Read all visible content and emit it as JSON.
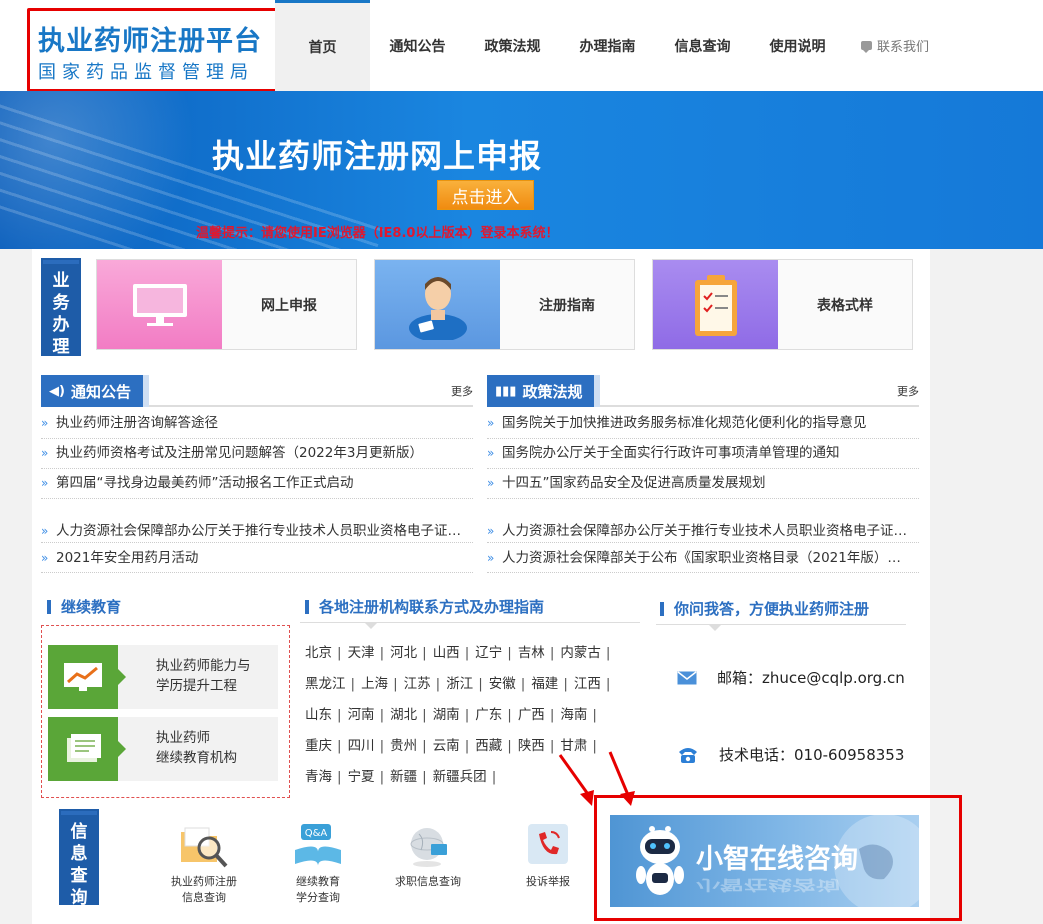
{
  "header": {
    "logo_title": "执业药师注册平台",
    "logo_sub": "国家药品监督管理局",
    "nav": [
      "首页",
      "通知公告",
      "政策法规",
      "办理指南",
      "信息查询",
      "使用说明"
    ],
    "contact": "联系我们"
  },
  "banner": {
    "title": "执业药师注册网上申报",
    "button": "点击进入",
    "tip": "温馨提示：请您使用IE浏览器（IE8.0以上版本）登录本系统！"
  },
  "business": {
    "label": "业务办理",
    "cards": [
      "网上申报",
      "注册指南",
      "表格式样"
    ]
  },
  "notice": {
    "title": "通知公告",
    "more": "更多",
    "items": [
      "执业药师注册咨询解答途径",
      "执业药师资格考试及注册常见问题解答（2022年3月更新版）",
      "第四届“寻找身边最美药师”活动报名工作正式启动",
      "人力资源社会保障部办公厅关于推行专业技术人员职业资格电子证书…",
      "2021年安全用药月活动"
    ]
  },
  "policy": {
    "title": "政策法规",
    "more": "更多",
    "items": [
      "国务院关于加快推进政务服务标准化规范化便利化的指导意见",
      "国务院办公厅关于全面实行行政许可事项清单管理的通知",
      "十四五”国家药品安全及促进高质量发展规划",
      "人力资源社会保障部办公厅关于推行专业技术人员职业资格电子证书…",
      "人力资源社会保障部关于公布《国家职业资格目录（2021年版）…"
    ]
  },
  "education": {
    "title": "继续教育",
    "items": [
      {
        "line1": "执业药师能力与",
        "line2": "学历提升工程"
      },
      {
        "line1": "执业药师",
        "line2": "继续教育机构"
      }
    ]
  },
  "regions": {
    "title": "各地注册机构联系方式及办理指南",
    "rows": [
      [
        "北京",
        "天津",
        "河北",
        "山西",
        "辽宁",
        "吉林",
        "内蒙古"
      ],
      [
        "黑龙江",
        "上海",
        "江苏",
        "浙江",
        "安徽",
        "福建",
        "江西"
      ],
      [
        "山东",
        "河南",
        "湖北",
        "湖南",
        "广东",
        "广西",
        "海南"
      ],
      [
        "重庆",
        "四川",
        "贵州",
        "云南",
        "西藏",
        "陕西",
        "甘肃"
      ],
      [
        "青海",
        "宁夏",
        "新疆",
        "新疆兵团"
      ]
    ]
  },
  "qa": {
    "title": "你问我答，方便执业药师注册",
    "email_label": "邮箱：zhuce@cqlp.org.cn",
    "phone_label": "技术电话：010-60958353"
  },
  "info": {
    "label": "信息查询",
    "items": [
      {
        "line1": "执业药师注册",
        "line2": "信息查询"
      },
      {
        "line1": "继续教育",
        "line2": "学分查询"
      },
      {
        "line1": "求职信息查询",
        "line2": ""
      },
      {
        "line1": "投诉举报",
        "line2": ""
      }
    ]
  },
  "consult": {
    "title": "小智在线咨询"
  },
  "colors": {
    "brand": "#1877c6",
    "accent": "#2c6fc1",
    "highlight": "#e60000",
    "button": "#f39a1c"
  }
}
